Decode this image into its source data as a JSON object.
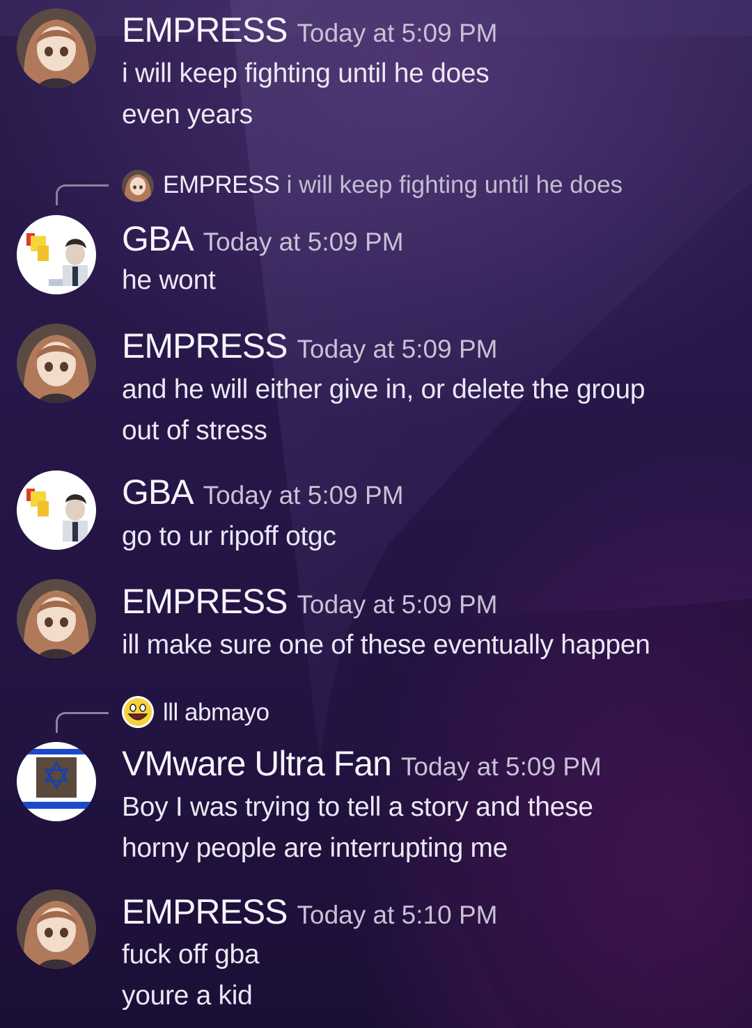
{
  "colors": {
    "background": "#241545",
    "username": "#f7f4fb",
    "timestamp": "#c9c2d6",
    "message_text": "#ece8f3",
    "reply_line": "#8b83a0"
  },
  "messages": [
    {
      "avatar_icon": "anime-girl-avatar",
      "username": "EMPRESS",
      "timestamp": "Today at 5:09 PM",
      "lines": [
        "i will keep fighting until he does",
        "even years"
      ]
    },
    {
      "reply_to": {
        "avatar_icon": "anime-girl-avatar",
        "username": "EMPRESS",
        "content": "i will keep fighting until he does"
      },
      "avatar_icon": "blocky-figure-avatar",
      "username": "GBA",
      "timestamp": "Today at 5:09 PM",
      "lines": [
        "he wont"
      ]
    },
    {
      "avatar_icon": "anime-girl-avatar",
      "username": "EMPRESS",
      "timestamp": "Today at 5:09 PM",
      "lines": [
        "and he will either give in, or delete the group",
        "out of stress"
      ]
    },
    {
      "avatar_icon": "blocky-figure-avatar",
      "username": "GBA",
      "timestamp": "Today at 5:09 PM",
      "lines": [
        "go to ur ripoff otgc"
      ]
    },
    {
      "avatar_icon": "anime-girl-avatar",
      "username": "EMPRESS",
      "timestamp": "Today at 5:09 PM",
      "lines": [
        "ill make sure one of these eventually happen"
      ]
    },
    {
      "reply_to": {
        "avatar_icon": "awesome-face-avatar",
        "username": "lll abmayo",
        "content": ""
      },
      "avatar_icon": "flag-star-avatar",
      "username": "VMware Ultra Fan",
      "timestamp": "Today at 5:09 PM",
      "lines": [
        "Boy I was trying to tell a story and these",
        "horny people are interrupting me"
      ]
    },
    {
      "avatar_icon": "anime-girl-avatar",
      "username": "EMPRESS",
      "timestamp": "Today at 5:10 PM",
      "lines": [
        "fuck off gba",
        "youre a kid"
      ]
    }
  ]
}
